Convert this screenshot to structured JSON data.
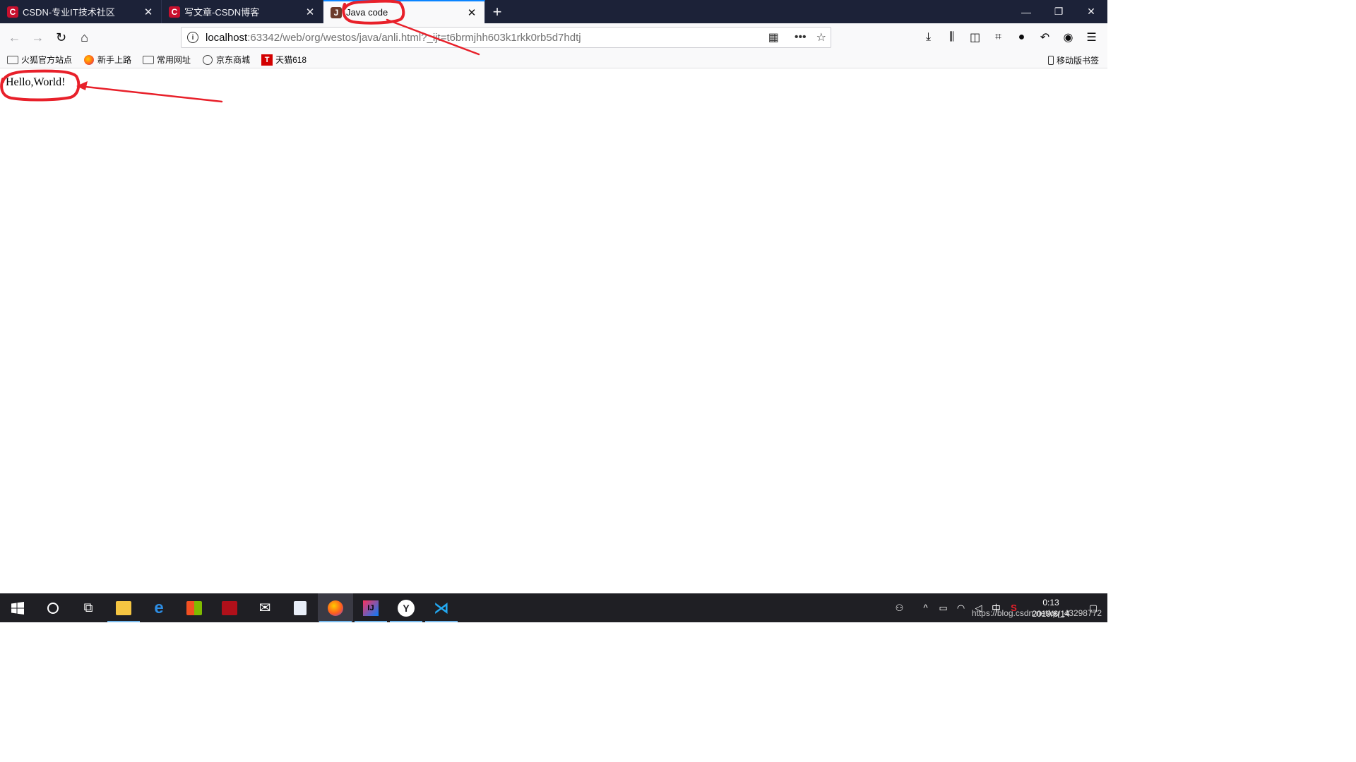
{
  "tabs": [
    {
      "title": "CSDN-专业IT技术社区",
      "favicon": "C",
      "active": false
    },
    {
      "title": "写文章-CSDN博客",
      "favicon": "C",
      "active": false
    },
    {
      "title": "Java code",
      "favicon": "J",
      "active": true
    }
  ],
  "window_controls": {
    "minimize": "—",
    "restore": "❐",
    "close": "✕"
  },
  "url": {
    "host": "localhost",
    "path": ":63342/web/org/westos/java/anli.html?_ijt=t6brmjhh603k1rkk0rb5d7hdtj"
  },
  "bookmarks": [
    {
      "label": "火狐官方站点",
      "icon": "folder-icon"
    },
    {
      "label": "新手上路",
      "icon": "firefox-icon"
    },
    {
      "label": "常用网址",
      "icon": "folder-icon"
    },
    {
      "label": "京东商城",
      "icon": "globe-icon"
    },
    {
      "label": "天猫618",
      "icon": "tmall-icon"
    }
  ],
  "mobile_bookmarks": "移动版书签",
  "page": {
    "text": "Hello,World!"
  },
  "annotation_color": "#e8202a",
  "taskbar": {
    "clock_time": "0:13",
    "clock_date": "2019/6/14",
    "ime": "中",
    "watermark": "https://blog.csdn.net/qq_43298772"
  }
}
